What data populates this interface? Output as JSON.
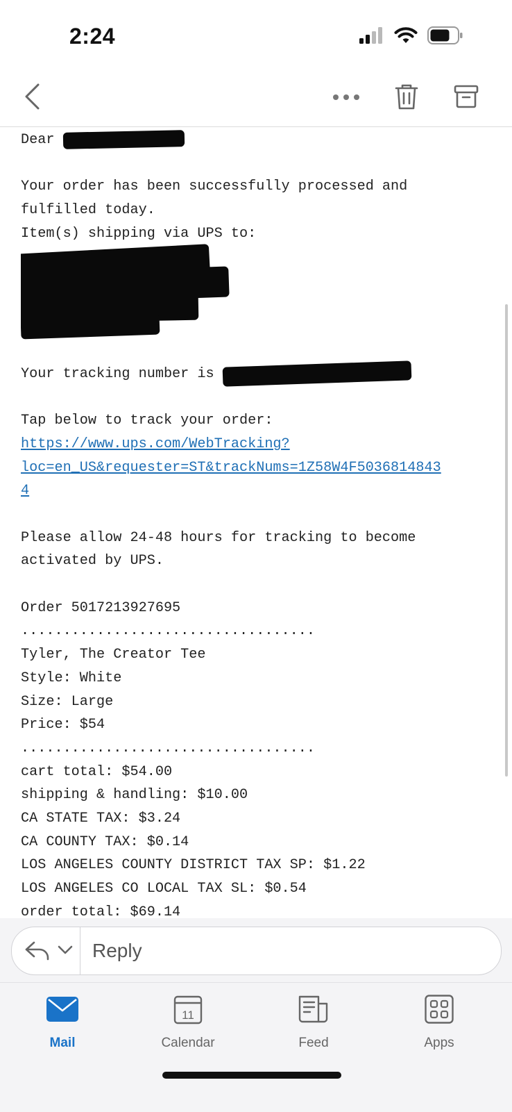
{
  "status_bar": {
    "time": "2:24",
    "icons": [
      "signal-icon",
      "wifi-icon",
      "battery-icon"
    ]
  },
  "nav": {
    "icons": [
      "back-chevron-icon",
      "more-icon",
      "trash-icon",
      "archive-icon"
    ]
  },
  "email": {
    "greeting": "Dear",
    "intro_line1": "Your order has been successfully processed and",
    "intro_line2": "fulfilled today.",
    "shipping_line": "Item(s) shipping via UPS to:",
    "tracking_prefix": "Your tracking number is",
    "tap_line": "Tap below to track your order:",
    "link_line1": "https://www.ups.com/WebTracking?",
    "link_line2": "loc=en_US&requester=ST&trackNums=1Z58W4F5036814843",
    "link_line3": "4",
    "allow_line1": "Please allow 24-48 hours for tracking to become",
    "allow_line2": "activated by UPS.",
    "order_line": "Order 5017213927695",
    "divider": "...................................",
    "item_name": "Tyler, The Creator Tee",
    "style": "Style: White",
    "size": "Size: Large",
    "price": "Price: $54",
    "divider2": "...................................",
    "cart_total": "cart total: $54.00",
    "shipping_handling": "shipping & handling: $10.00",
    "ca_state_tax": "CA STATE TAX: $3.24",
    "ca_county_tax": "CA COUNTY TAX: $0.14",
    "la_district_tax": "LOS ANGELES COUNTY DISTRICT TAX SP: $1.22",
    "la_local_tax": "LOS ANGELES CO LOCAL TAX SL: $0.54",
    "order_total": "order total: $69.14"
  },
  "reply": {
    "label": "Reply"
  },
  "tabs": [
    {
      "label": "Mail",
      "icon": "mail-icon",
      "active": true
    },
    {
      "label": "Calendar",
      "icon": "calendar-icon",
      "day": "11"
    },
    {
      "label": "Feed",
      "icon": "feed-icon"
    },
    {
      "label": "Apps",
      "icon": "apps-icon"
    }
  ],
  "colors": {
    "accent": "#1a73c8",
    "link": "#1f6fb5"
  }
}
